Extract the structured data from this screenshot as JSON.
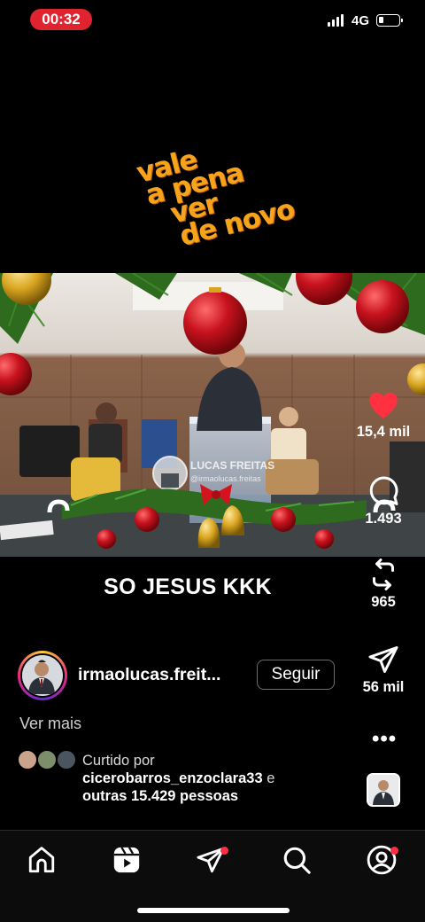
{
  "status_bar": {
    "time": "00:32",
    "network": "4G"
  },
  "logo": {
    "lines": [
      "vale",
      "a pena",
      "ver",
      "de novo"
    ]
  },
  "video": {
    "watermark_name": "LUCAS FREITAS",
    "watermark_handle": "@irmaolucas.freitas"
  },
  "caption": "SO JESUS KKK",
  "actions": {
    "likes": "15,4 mil",
    "comments": "1.493",
    "reposts": "965",
    "shares": "56 mil",
    "more_icon": "more-dots-icon"
  },
  "author": {
    "username": "irmaolucas.freit...",
    "follow_label": "Seguir"
  },
  "description": {
    "see_more": "Ver mais"
  },
  "liked_by": {
    "prefix": "Curtido por",
    "names": "cicerobarros_enzoclara33",
    "connector": "e",
    "others": "outras 15.429 pessoas"
  },
  "bottom_nav": {
    "items": [
      "home-icon",
      "reels-icon",
      "send-icon",
      "search-icon",
      "profile-icon"
    ]
  },
  "colors": {
    "like_red": "#ff3040",
    "badge_red": "#ff2d46",
    "time_pill": "#e0242f",
    "logo_orange": "#f7a41d"
  }
}
